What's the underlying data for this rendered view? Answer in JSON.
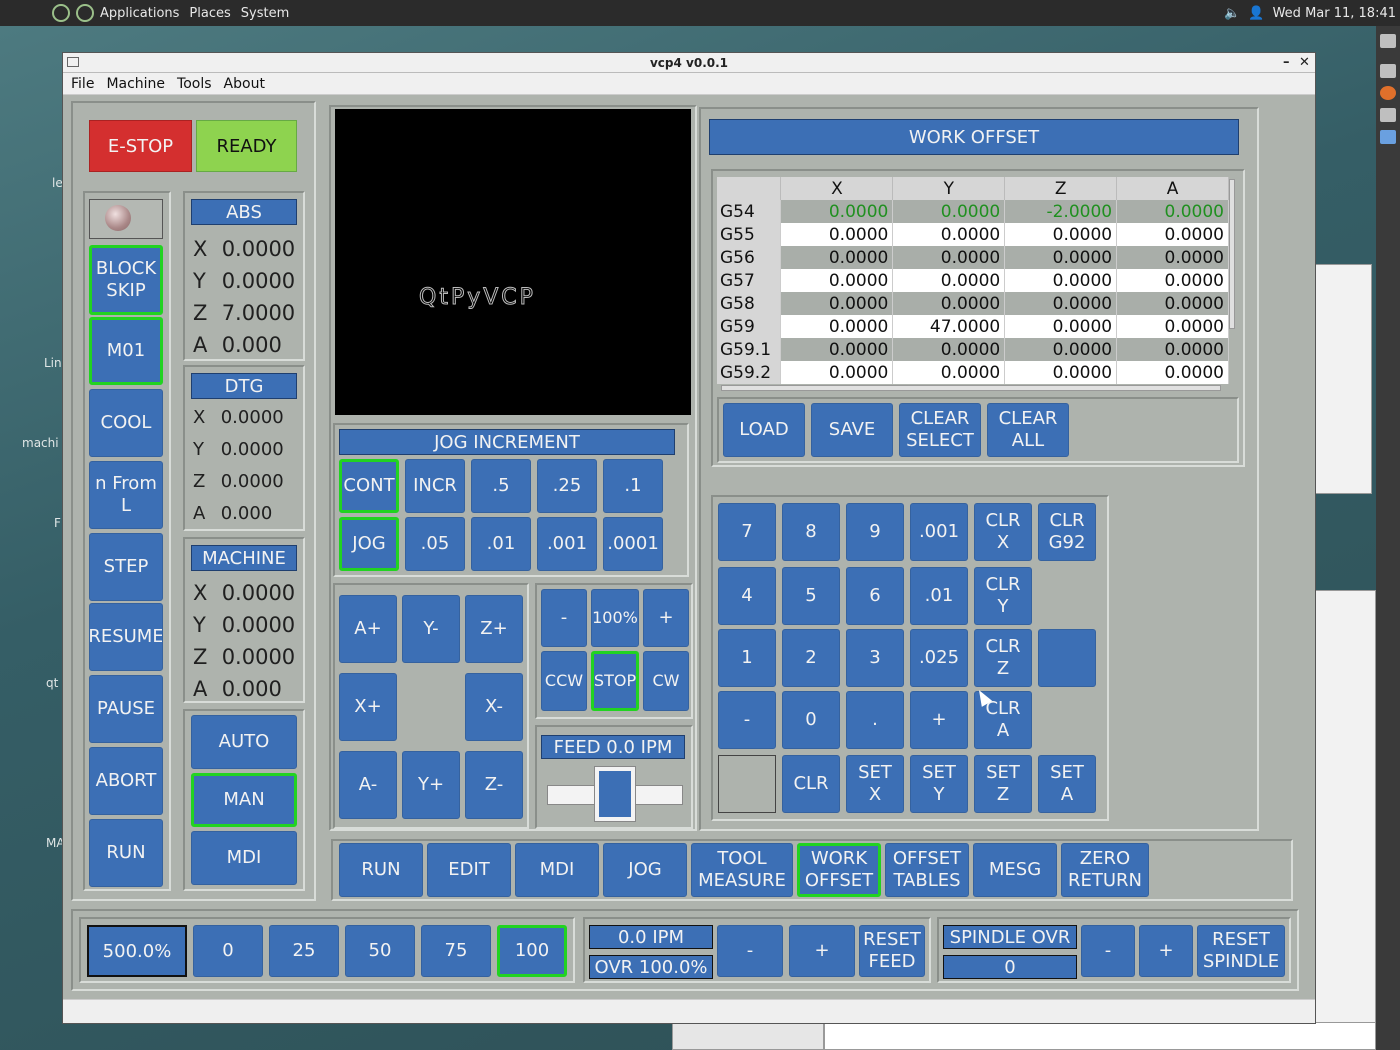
{
  "desktop": {
    "menus": [
      "Applications",
      "Places",
      "System"
    ],
    "clock": "Wed Mar 11, 18:41",
    "labels": [
      "le",
      "Lin",
      "machi",
      "F",
      "qt",
      "MA"
    ]
  },
  "window": {
    "title": "vcp4 v0.0.1",
    "menu": [
      "File",
      "Machine",
      "Tools",
      "About"
    ]
  },
  "machine_state": {
    "estop_label": "E-STOP",
    "ready_label": "READY"
  },
  "left_buttons": [
    "BLOCK\nSKIP",
    "M01",
    "COOL",
    "n From L",
    "STEP",
    "RESUME",
    "PAUSE",
    "ABORT",
    "RUN"
  ],
  "dro": {
    "abs_title": "ABS",
    "abs": [
      {
        "axis": "X",
        "value": "0.0000"
      },
      {
        "axis": "Y",
        "value": "0.0000"
      },
      {
        "axis": "Z",
        "value": "7.0000"
      },
      {
        "axis": "A",
        "value": "0.000"
      }
    ],
    "dtg_title": "DTG",
    "dtg": [
      {
        "axis": "X",
        "value": "0.0000"
      },
      {
        "axis": "Y",
        "value": "0.0000"
      },
      {
        "axis": "Z",
        "value": "0.0000"
      },
      {
        "axis": "A",
        "value": "0.000"
      }
    ],
    "machine_title": "MACHINE",
    "machine": [
      {
        "axis": "X",
        "value": "0.0000"
      },
      {
        "axis": "Y",
        "value": "0.0000"
      },
      {
        "axis": "Z",
        "value": "0.0000"
      },
      {
        "axis": "A",
        "value": "0.000"
      }
    ]
  },
  "mode_buttons": [
    "AUTO",
    "MAN",
    "MDI"
  ],
  "preview": {
    "logo_text": "QtPyVCP"
  },
  "jog": {
    "title": "JOG INCREMENT",
    "row1": [
      "CONT",
      "INCR",
      ".5",
      ".25",
      ".1"
    ],
    "row2": [
      "JOG",
      ".05",
      ".01",
      ".001",
      ".0001"
    ],
    "axis_buttons": [
      "A+",
      "Y-",
      "Z+",
      "X+",
      "X-",
      "A-",
      "Y+",
      "Z-"
    ]
  },
  "spindle": {
    "minus": "-",
    "percent": "100%",
    "plus": "+",
    "ccw": "CCW",
    "stop": "STOP",
    "cw": "CW"
  },
  "feed": {
    "label": "FEED 0.0  IPM",
    "slider_percent": 50
  },
  "work_offset": {
    "title": "WORK OFFSET",
    "columns": [
      "",
      "X",
      "Y",
      "Z",
      "A"
    ],
    "rows": [
      {
        "name": "G54",
        "values": [
          "0.0000",
          "0.0000",
          "-2.0000",
          "0.0000"
        ]
      },
      {
        "name": "G55",
        "values": [
          "0.0000",
          "0.0000",
          "0.0000",
          "0.0000"
        ]
      },
      {
        "name": "G56",
        "values": [
          "0.0000",
          "0.0000",
          "0.0000",
          "0.0000"
        ]
      },
      {
        "name": "G57",
        "values": [
          "0.0000",
          "0.0000",
          "0.0000",
          "0.0000"
        ]
      },
      {
        "name": "G58",
        "values": [
          "0.0000",
          "0.0000",
          "0.0000",
          "0.0000"
        ]
      },
      {
        "name": "G59",
        "values": [
          "0.0000",
          "47.0000",
          "0.0000",
          "0.0000"
        ]
      },
      {
        "name": "G59.1",
        "values": [
          "0.0000",
          "0.0000",
          "0.0000",
          "0.0000"
        ]
      },
      {
        "name": "G59.2",
        "values": [
          "0.0000",
          "0.0000",
          "0.0000",
          "0.0000"
        ]
      }
    ],
    "buttons": [
      "LOAD",
      "SAVE",
      "CLEAR\nSELECT",
      "CLEAR\nALL"
    ]
  },
  "keypad": {
    "keys": [
      "7",
      "8",
      "9",
      ".001",
      "CLR\nX",
      "CLR\nG92",
      "4",
      "5",
      "6",
      ".01",
      "CLR\nY",
      "1",
      "2",
      "3",
      ".025",
      "CLR\nZ",
      "",
      "-",
      "0",
      ".",
      "+",
      "CLR\nA",
      "CLR",
      "SET\nX",
      "SET\nY",
      "SET\nZ",
      "SET\nA"
    ]
  },
  "tabs": [
    "RUN",
    "EDIT",
    "MDI",
    "JOG",
    "TOOL\nMEASURE",
    "WORK\nOFFSET",
    "OFFSET\nTABLES",
    "MESG",
    "ZERO\nRETURN"
  ],
  "bottom": {
    "rapid_display": "500.0%",
    "rapid_buttons": [
      "0",
      "25",
      "50",
      "75",
      "100"
    ],
    "feed_display": "0.0  IPM",
    "feed_ovr": "OVR 100.0%",
    "feed_minus": "-",
    "feed_plus": "+",
    "reset_feed": "RESET\nFEED",
    "spindle_ovr_label": "SPINDLE OVR",
    "spindle_ovr_value": "0",
    "spindle_minus": "-",
    "spindle_plus": "+",
    "reset_spindle": "RESET\nSPINDLE"
  }
}
